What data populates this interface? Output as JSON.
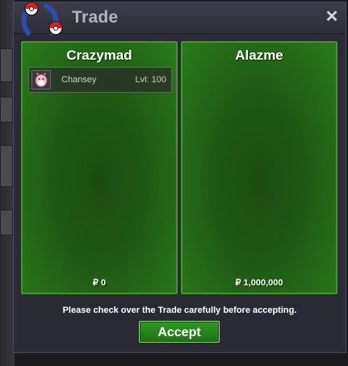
{
  "window": {
    "title": "Trade",
    "close_symbol": "✕"
  },
  "trade": {
    "left": {
      "name": "Crazymad",
      "money": "₽ 0",
      "items": [
        {
          "icon": "chansey-icon",
          "name": "Chansey",
          "level": "Lvl: 100"
        }
      ]
    },
    "right": {
      "name": "Alazme",
      "money": "₽ 1,000,000",
      "items": []
    }
  },
  "footer": {
    "notice": "Please check over the Trade carefully before accepting.",
    "accept_label": "Accept"
  },
  "colors": {
    "panel_border": "#3f9a2a",
    "panel_fill": "#1f5a14",
    "accept_button": "#2f9a22",
    "window_bg": "#2c2c38"
  }
}
